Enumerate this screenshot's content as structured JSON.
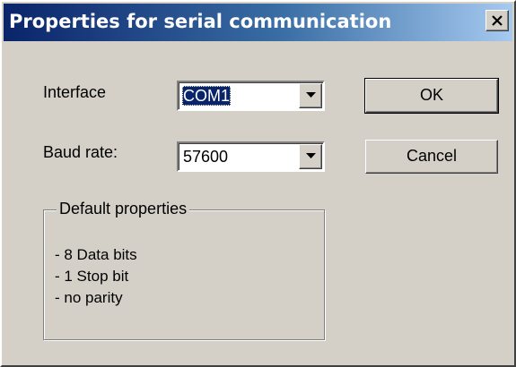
{
  "window": {
    "title": "Properties for serial communication"
  },
  "interface": {
    "label": "Interface",
    "value": "COM1"
  },
  "baud_rate": {
    "label": "Baud rate:",
    "value": "57600"
  },
  "buttons": {
    "ok": "OK",
    "cancel": "Cancel"
  },
  "default_properties": {
    "title": "Default properties",
    "lines": [
      "- 8 Data bits",
      "- 1 Stop bit",
      "- no parity"
    ]
  },
  "colors": {
    "title_bar_start": "#0a246a",
    "title_bar_end": "#a6caf0",
    "face": "#d4d0c8",
    "selection": "#0a246a"
  },
  "icons": {
    "close": "close-icon",
    "dropdown": "chevron-down-icon"
  }
}
